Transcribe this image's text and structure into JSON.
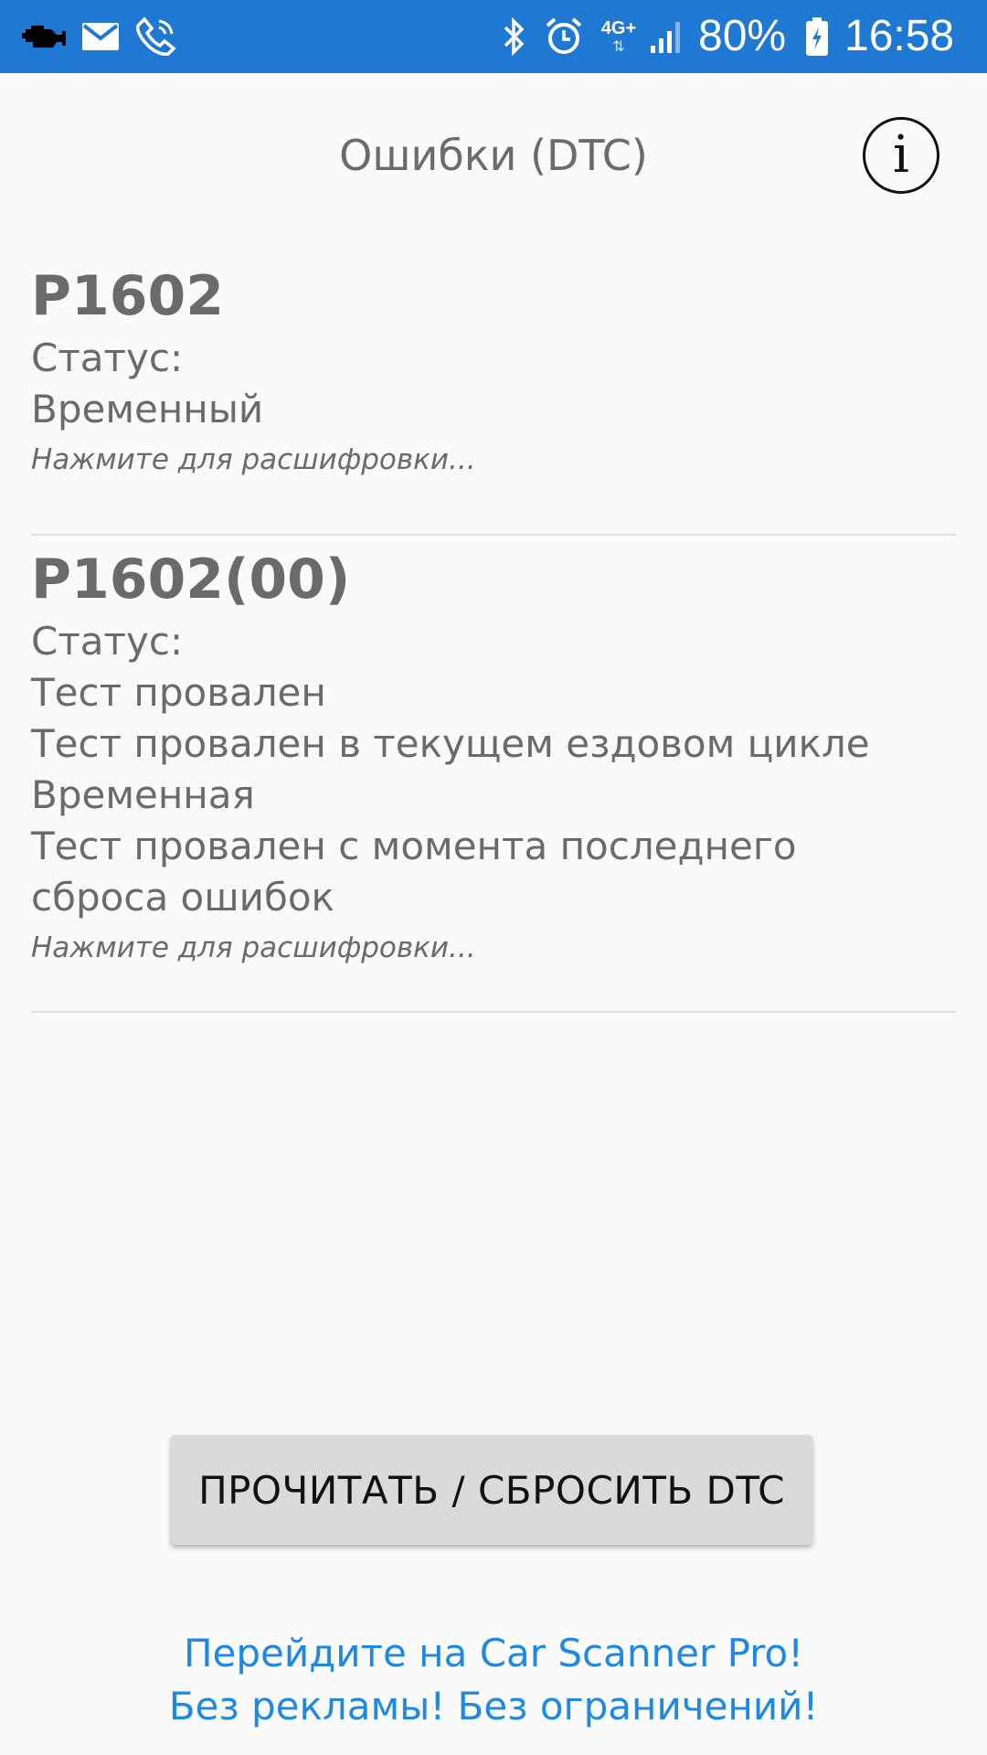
{
  "status_bar": {
    "battery": "80%",
    "time": "16:58",
    "network": "4G+",
    "icons": [
      "car-engine-icon",
      "mail-icon",
      "phone-wifi-call-icon",
      "bluetooth-icon",
      "alarm-icon",
      "signal-icon",
      "battery-charging-icon"
    ]
  },
  "header": {
    "title": "Ошибки (DTC)",
    "info_icon": "info-icon"
  },
  "dtc_items": [
    {
      "code": "P1602",
      "status_label": "Статус:",
      "status_lines": [
        "Временный"
      ],
      "hint": "Нажмите для расшифровки..."
    },
    {
      "code": "P1602(00)",
      "status_label": "Статус:",
      "status_lines": [
        "Тест провален",
        "Тест провален в текущем ездовом цикле",
        "Временная",
        "Тест провален с момента последнего",
        "сброса ошибок"
      ],
      "hint": "Нажмите для расшифровки..."
    }
  ],
  "actions": {
    "read_reset_label": "ПРОЧИТАТЬ / СБРОСИТЬ DTC"
  },
  "promo": {
    "line1": "Перейдите на Car Scanner Pro!",
    "line2": "Без рекламы! Без ограничений!"
  },
  "colors": {
    "status_bar": "#1f78d1",
    "background": "#fafafa",
    "text_gray": "#6a6a6a",
    "button_bg": "#dadada",
    "link_blue": "#1e88e5"
  }
}
